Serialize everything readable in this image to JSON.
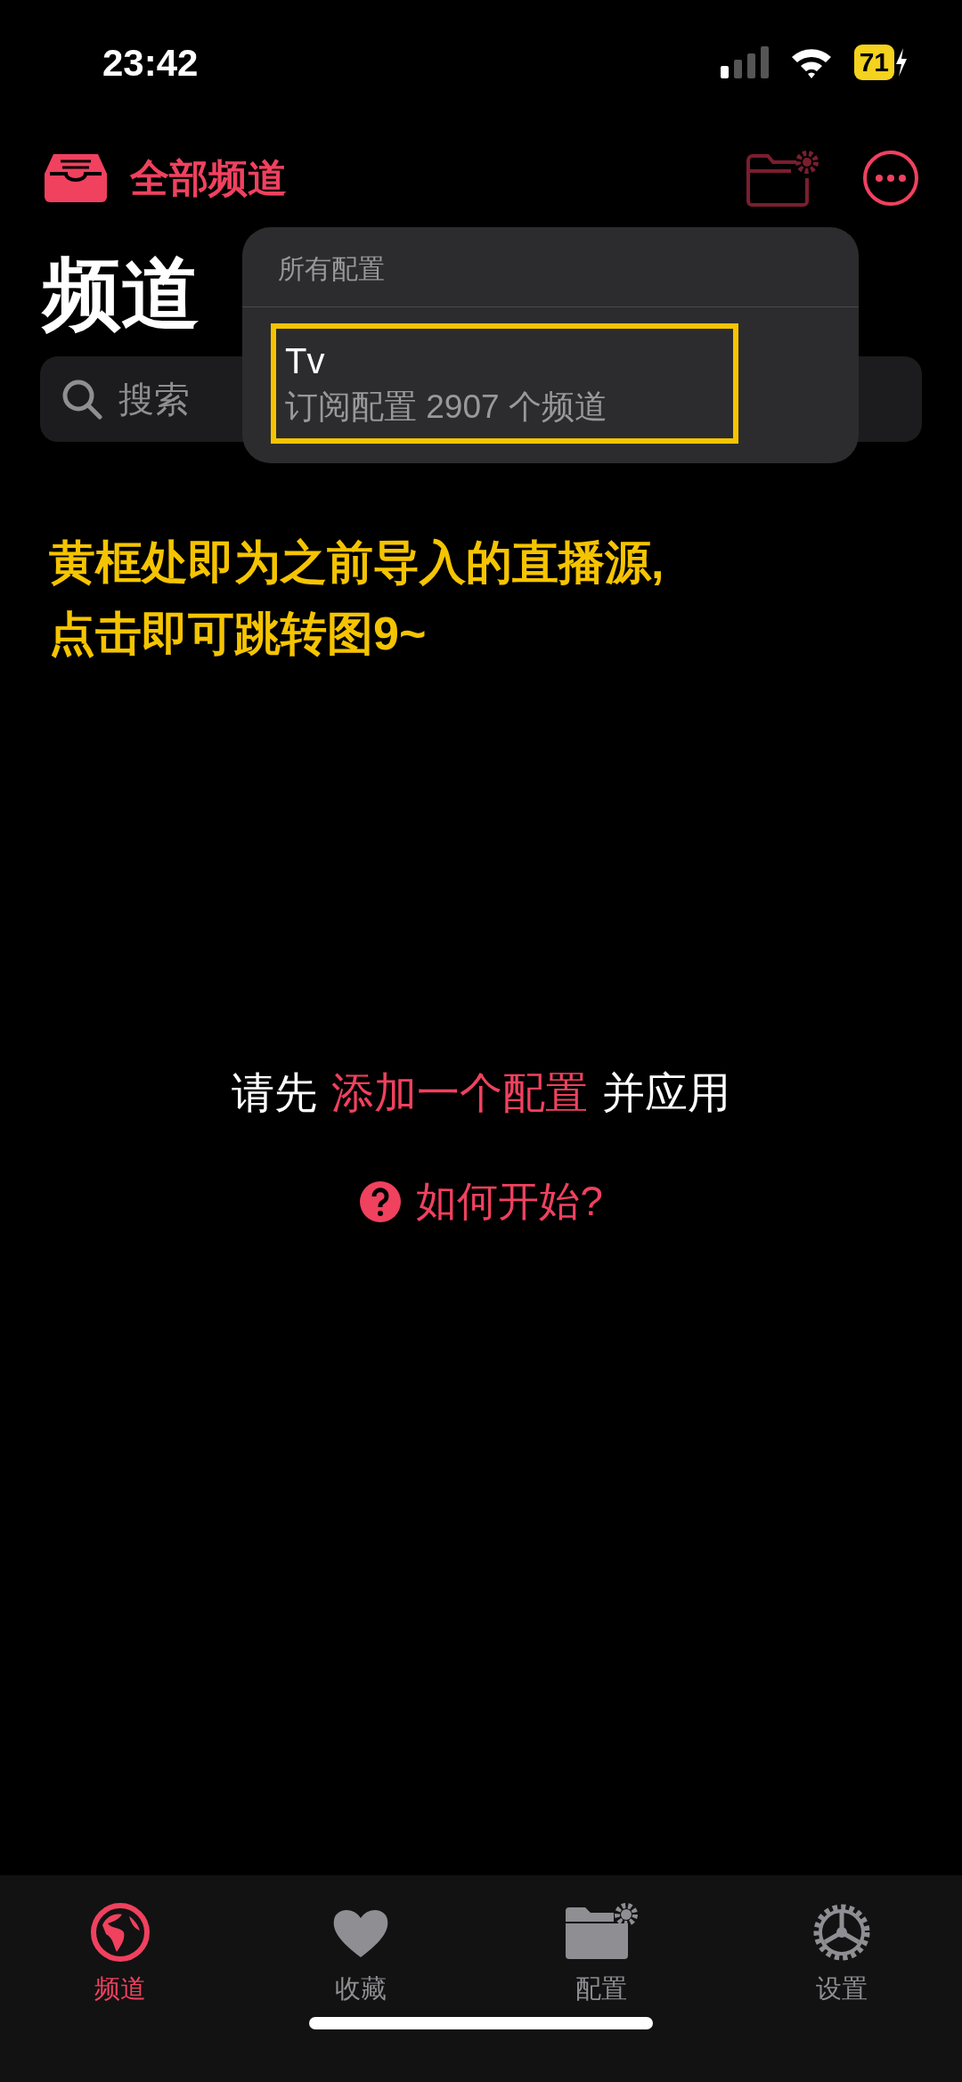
{
  "status_bar": {
    "time": "23:42",
    "battery": "71"
  },
  "nav": {
    "filter_label": "全部频道",
    "config_button": {
      "disabled": true
    }
  },
  "page_title": "频道",
  "search": {
    "placeholder": "搜索"
  },
  "config_menu": {
    "header": "所有配置",
    "items": [
      {
        "title": "Tv",
        "subtitle": "订阅配置 2907 个频道",
        "highlighted": true
      }
    ]
  },
  "annotation": [
    "黄框处即为之前导入的直播源,",
    "点击即可跳转图9~"
  ],
  "empty_state": {
    "before": "请先",
    "link": "添加一个配置",
    "after": "并应用",
    "help": "如何开始?"
  },
  "tabs": [
    {
      "label": "频道",
      "selected": true
    },
    {
      "label": "收藏",
      "selected": false
    },
    {
      "label": "配置",
      "selected": false
    },
    {
      "label": "设置",
      "selected": false
    }
  ]
}
